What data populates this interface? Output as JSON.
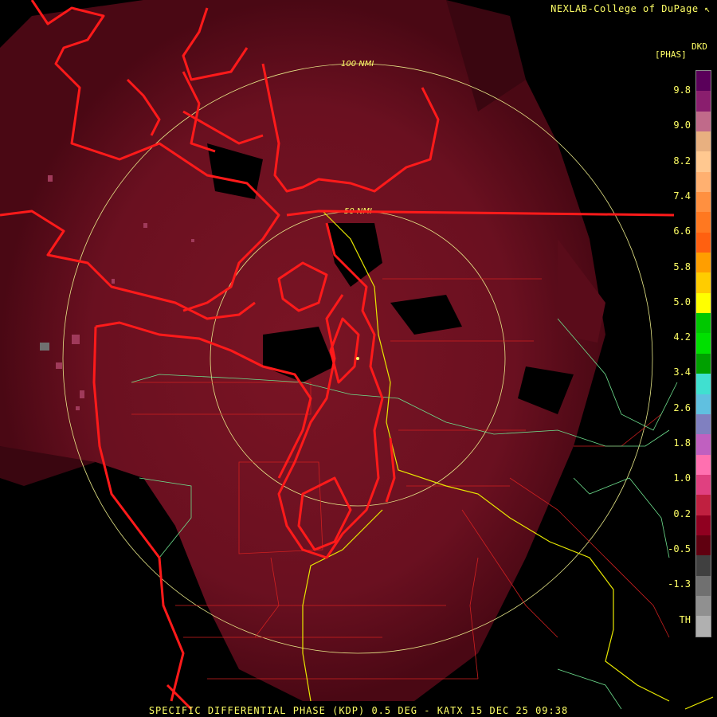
{
  "header": {
    "credit": "NEXLAB-College of DuPage ↖"
  },
  "legend": {
    "unit": "[PHAS]",
    "code": "DKD",
    "labels": [
      "9.8",
      "9.0",
      "8.2",
      "7.4",
      "6.6",
      "5.8",
      "5.0",
      "4.2",
      "3.4",
      "2.6",
      "1.8",
      "1.0",
      "0.2",
      "-0.5",
      "-1.3",
      "TH"
    ],
    "colors": [
      "#5a005a",
      "#8a1e6e",
      "#c06a8a",
      "#e8b080",
      "#ffc890",
      "#ffb070",
      "#ff9040",
      "#ff7820",
      "#ff6010",
      "#ff9e00",
      "#ffcc00",
      "#ffff00",
      "#00c800",
      "#00e000",
      "#00a000",
      "#40e0d0",
      "#60c0e0",
      "#8080c0",
      "#c060c0",
      "#ff70b0",
      "#e04080",
      "#c02040",
      "#900020",
      "#600010",
      "#404040",
      "#707070",
      "#909090",
      "#b0b0b0"
    ]
  },
  "rings": {
    "inner_label": "50 NMI",
    "outer_label": "100 NMI"
  },
  "footer": {
    "caption": "SPECIFIC DIFFERENTIAL PHASE (KDP) 0.5 DEG - KATX 15 DEC 25 09:38"
  }
}
